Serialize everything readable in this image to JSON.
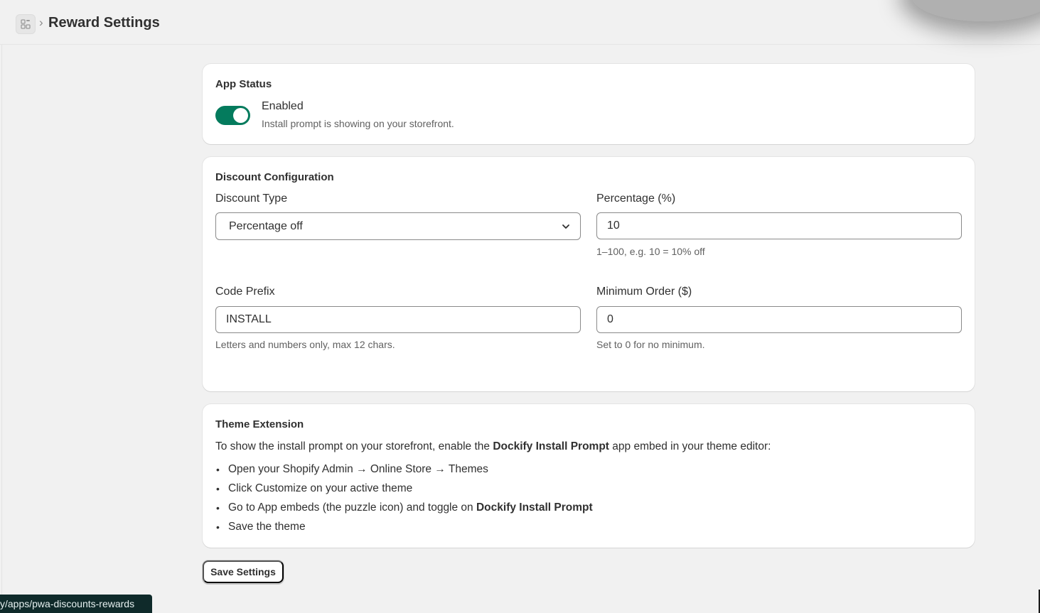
{
  "header": {
    "app_icon": "app-grid-icon",
    "separator": "›",
    "title": "Reward Settings"
  },
  "app_status": {
    "title": "App Status",
    "toggle_on": true,
    "status_label": "Enabled",
    "status_description": "Install prompt is showing on your storefront."
  },
  "discount": {
    "title": "Discount Configuration",
    "type_label": "Discount Type",
    "type_value": "Percentage off",
    "percentage_label": "Percentage (%)",
    "percentage_value": "10",
    "percentage_help": "1–100, e.g. 10 = 10% off",
    "prefix_label": "Code Prefix",
    "prefix_value": "INSTALL",
    "prefix_help": "Letters and numbers only, max 12 chars.",
    "min_order_label": "Minimum Order ($)",
    "min_order_value": "0",
    "min_order_help": "Set to 0 for no minimum."
  },
  "theme_extension": {
    "title": "Theme Extension",
    "intro_before": "To show the install prompt on your storefront, enable the ",
    "intro_bold": "Dockify Install Prompt",
    "intro_after": " app embed in your theme editor:",
    "step1": "Open your Shopify Admin → Online Store → Themes",
    "step2": "Click Customize on your active theme",
    "step3_before": "Go to App embeds (the puzzle icon) and toggle on ",
    "step3_bold": "Dockify Install Prompt",
    "step4": "Save the theme"
  },
  "actions": {
    "save_label": "Save Settings"
  },
  "status_bar": {
    "url": "y/apps/pwa-discounts-rewards"
  },
  "colors": {
    "toggle_on": "#047b5d",
    "background": "#f1f1f1",
    "card": "#ffffff"
  }
}
